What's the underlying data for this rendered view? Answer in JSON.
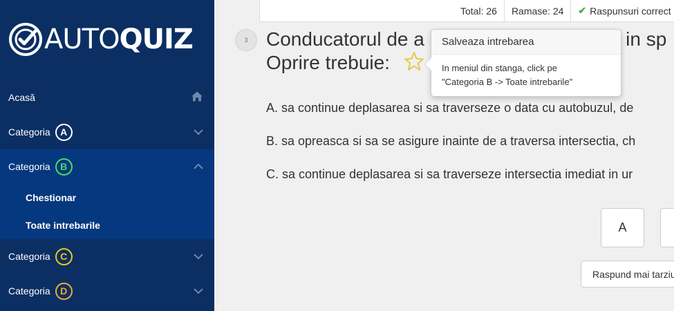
{
  "logo": {
    "part1": "AUTO",
    "part2": "QUIZ"
  },
  "sidebar": {
    "home": "Acasă",
    "categories": [
      {
        "label": "Categoria",
        "letter": "A",
        "color": "#ffffff"
      },
      {
        "label": "Categoria",
        "letter": "B",
        "color": "#4cd964"
      },
      {
        "label": "Categoria",
        "letter": "C",
        "color": "#f0c419"
      },
      {
        "label": "Categoria",
        "letter": "D",
        "color": "#f0a830"
      }
    ],
    "submenu": [
      "Chestionar",
      "Toate intrebarile"
    ]
  },
  "stats": {
    "total": "Total: 26",
    "remaining": "Ramase: 24",
    "correct": "Raspunsuri correct"
  },
  "question": {
    "number": "3",
    "line1": "Conducatorul de autobuz care se apropie de o intersectie marcata cu indicatorul in sp",
    "line1_left": "Conducatorul de a",
    "line1_right": "a in sp",
    "line2": "Oprire trebuie:"
  },
  "popover": {
    "title": "Salveaza intrebarea",
    "body_line1": "In meniul din stanga, click pe",
    "body_line2": "\"Categoria B -> Toate intrebarile\""
  },
  "answers": [
    "A. sa continue deplasarea si sa traverseze o data cu autobuzul, de",
    "B. sa opreasca si sa se asigure inainte de a traversa intersectia, ch",
    "C. sa continue deplasarea si sa traverseze intersectia imediat in ur"
  ],
  "buttons": {
    "a": "A",
    "later": "Raspund mai tarziu"
  }
}
